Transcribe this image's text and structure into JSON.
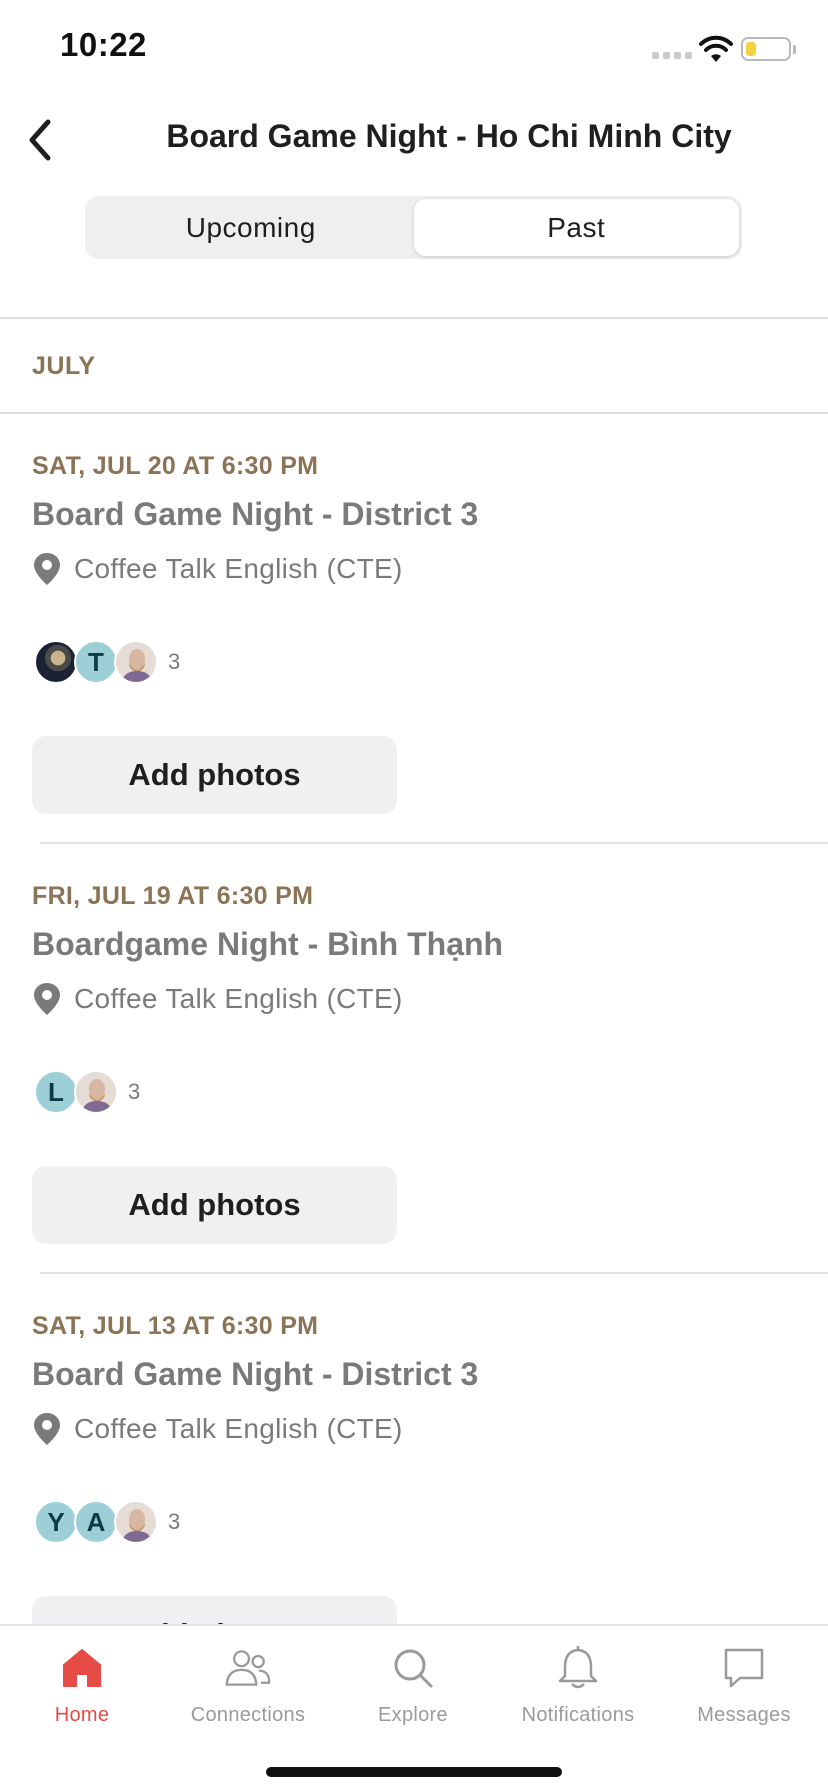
{
  "status_bar": {
    "time": "10:22"
  },
  "header": {
    "title": "Board Game Night - Ho Chi Minh City"
  },
  "segments": [
    {
      "label": "Upcoming",
      "active": false
    },
    {
      "label": "Past",
      "active": true
    }
  ],
  "month": "JULY",
  "events": [
    {
      "date": "SAT, JUL 20 AT 6:30 PM",
      "title": "Board Game Night - District 3",
      "venue": "Coffee Talk English (CTE)",
      "attendees": [
        "photo",
        "T",
        "photo"
      ],
      "attendee_count": "3",
      "action_label": "Add photos"
    },
    {
      "date": "FRI, JUL 19 AT 6:30 PM",
      "title": "Boardgame Night - Bình Thạnh",
      "venue": "Coffee Talk English (CTE)",
      "attendees": [
        "L",
        "photo"
      ],
      "attendee_count": "3",
      "action_label": "Add photos"
    },
    {
      "date": "SAT, JUL 13 AT 6:30 PM",
      "title": "Board Game Night - District 3",
      "venue": "Coffee Talk English (CTE)",
      "attendees": [
        "Y",
        "A",
        "photo"
      ],
      "attendee_count": "3",
      "action_label": "Add photos"
    }
  ],
  "tab_bar": [
    {
      "label": "Home",
      "icon": "home-icon",
      "active": true
    },
    {
      "label": "Connections",
      "icon": "connections-icon",
      "active": false
    },
    {
      "label": "Explore",
      "icon": "search-icon",
      "active": false
    },
    {
      "label": "Notifications",
      "icon": "bell-icon",
      "active": false
    },
    {
      "label": "Messages",
      "icon": "chat-icon",
      "active": false
    }
  ],
  "colors": {
    "accent": "#e64b45",
    "date_text": "#8b7355",
    "avatar_initial_bg": "#9ccfd6"
  }
}
